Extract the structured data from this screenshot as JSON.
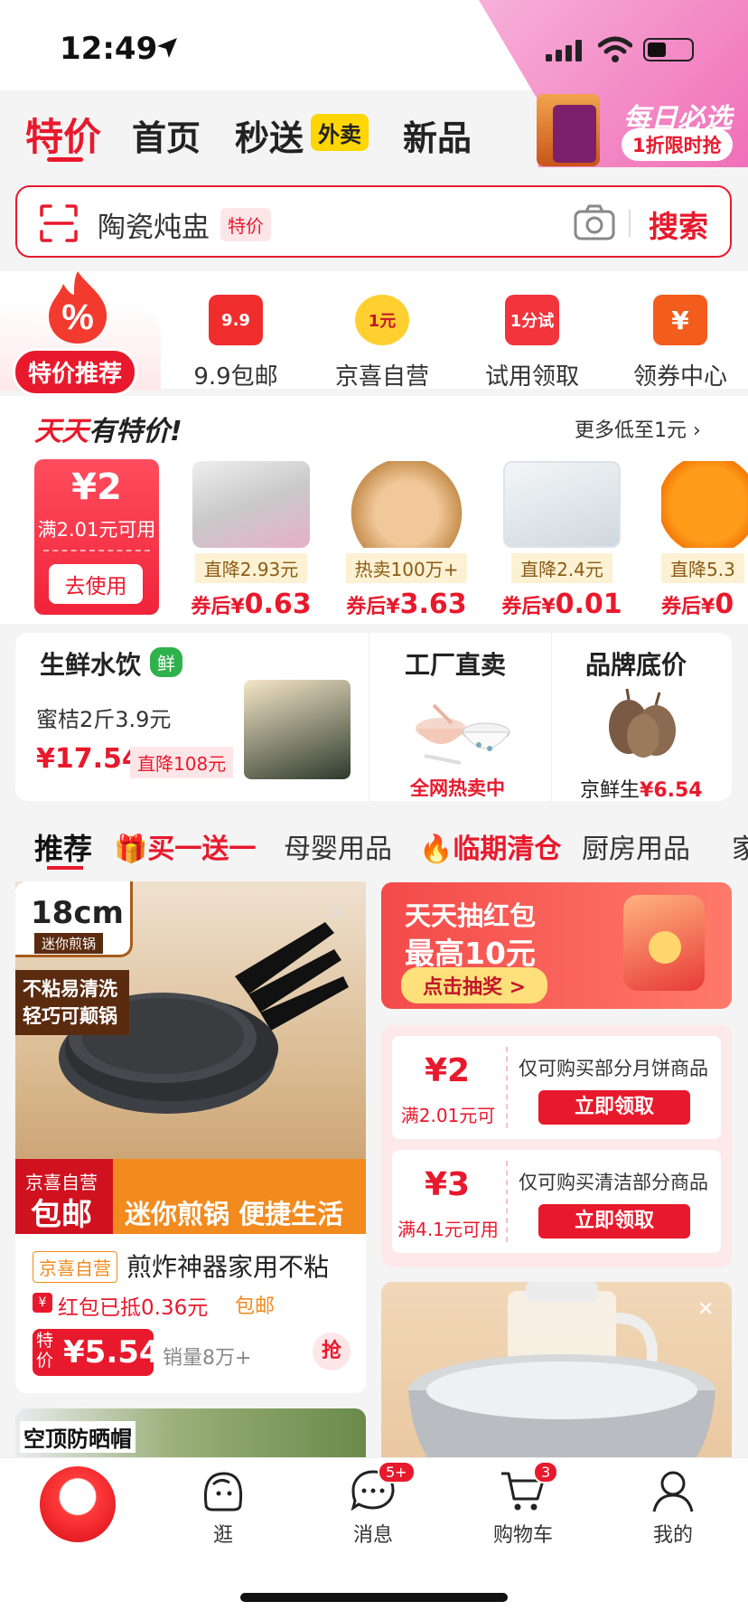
{
  "status_bar": {
    "time": "12:49"
  },
  "top_tabs": {
    "special": "特价",
    "home": "首页",
    "second_delivery": "秒送",
    "takeout_badge": "外卖",
    "new": "新品"
  },
  "promo_corner": {
    "title": "每日必选",
    "subtitle": "1折限时抢"
  },
  "search": {
    "query": "陶瓷炖盅",
    "tag": "特价",
    "button": "搜索"
  },
  "categories": [
    {
      "label": "特价推荐",
      "icon": "percent-fire-icon"
    },
    {
      "label": "9.9包邮",
      "icon_text": "9.9",
      "icon": "tag-9-9-icon"
    },
    {
      "label": "京喜自营",
      "icon_text": "1元",
      "icon": "one-yuan-badge-icon"
    },
    {
      "label": "试用领取",
      "icon_text": "1分试",
      "icon": "trial-bag-icon"
    },
    {
      "label": "领券中心",
      "icon_text": "¥",
      "icon": "coupon-center-icon"
    }
  ],
  "daily_deals": {
    "title_red": "天天",
    "title_black": "有特价!",
    "more": "更多低至1元",
    "coupon": {
      "amount": "¥2",
      "condition": "满2.01元可用",
      "button": "去使用"
    },
    "items": [
      {
        "drop": "直降2.93元",
        "after_prefix": "券后¥",
        "after": "0.63"
      },
      {
        "drop": "热卖100万+",
        "after_prefix": "券后¥",
        "after": "3.63"
      },
      {
        "drop": "直降2.4元",
        "after_prefix": "券后¥",
        "after": "0.01"
      },
      {
        "drop": "直降5.3",
        "after_prefix": "券后¥",
        "after": "0"
      }
    ]
  },
  "tri_card": {
    "fresh": {
      "title": "生鲜水饮",
      "badge": "鲜",
      "desc": "蜜桔2斤3.9元",
      "price": "¥17.54",
      "drop": "直降108元"
    },
    "factory": {
      "title": "工厂直卖",
      "sub": "全网热卖中"
    },
    "brand": {
      "title": "品牌底价",
      "sub_prefix": "京鲜生",
      "sub_price": "¥6.54"
    }
  },
  "feed_tabs": [
    "推荐",
    "买一送一",
    "母婴用品",
    "临期清仓",
    "厨房用品",
    "家"
  ],
  "product": {
    "size": "18cm",
    "size_sub": "迷你煎锅",
    "nonstick": "不粘易清洗 轻巧可颠锅",
    "banner_jx": "京喜自营",
    "banner_ship": "包邮",
    "banner_slogan": "迷你煎锅 便捷生活",
    "tag": "京喜自营",
    "name": "煎炸神器家用不粘",
    "redpack": "红包已抵0.36元",
    "freeship": "包邮",
    "price_tag": "特价",
    "price": "¥5.54",
    "sales": "销量8万+",
    "grab": "抢"
  },
  "product2": {
    "text": "空顶防晒帽"
  },
  "lucky_draw": {
    "line1": "天天抽红包",
    "line2": "最高10元",
    "button": "点击抽奖 >"
  },
  "coupons": [
    {
      "amount": "¥2",
      "condition": "满2.01元可",
      "desc": "仅可购买部分月饼商品",
      "button": "立即领取"
    },
    {
      "amount": "¥3",
      "condition": "满4.1元可用",
      "desc": "仅可购买清洁部分商品",
      "button": "立即领取"
    }
  ],
  "bottom_nav": [
    {
      "label": "",
      "icon": "jd-mascot-home-icon"
    },
    {
      "label": "逛",
      "icon": "browse-face-icon"
    },
    {
      "label": "消息",
      "icon": "message-bubble-icon",
      "badge": "5+"
    },
    {
      "label": "购物车",
      "icon": "cart-icon",
      "badge": "3"
    },
    {
      "label": "我的",
      "icon": "profile-icon"
    }
  ],
  "colors": {
    "accent": "#e8192c",
    "orange": "#f28a1e",
    "fresh_green": "#2fb14c"
  }
}
